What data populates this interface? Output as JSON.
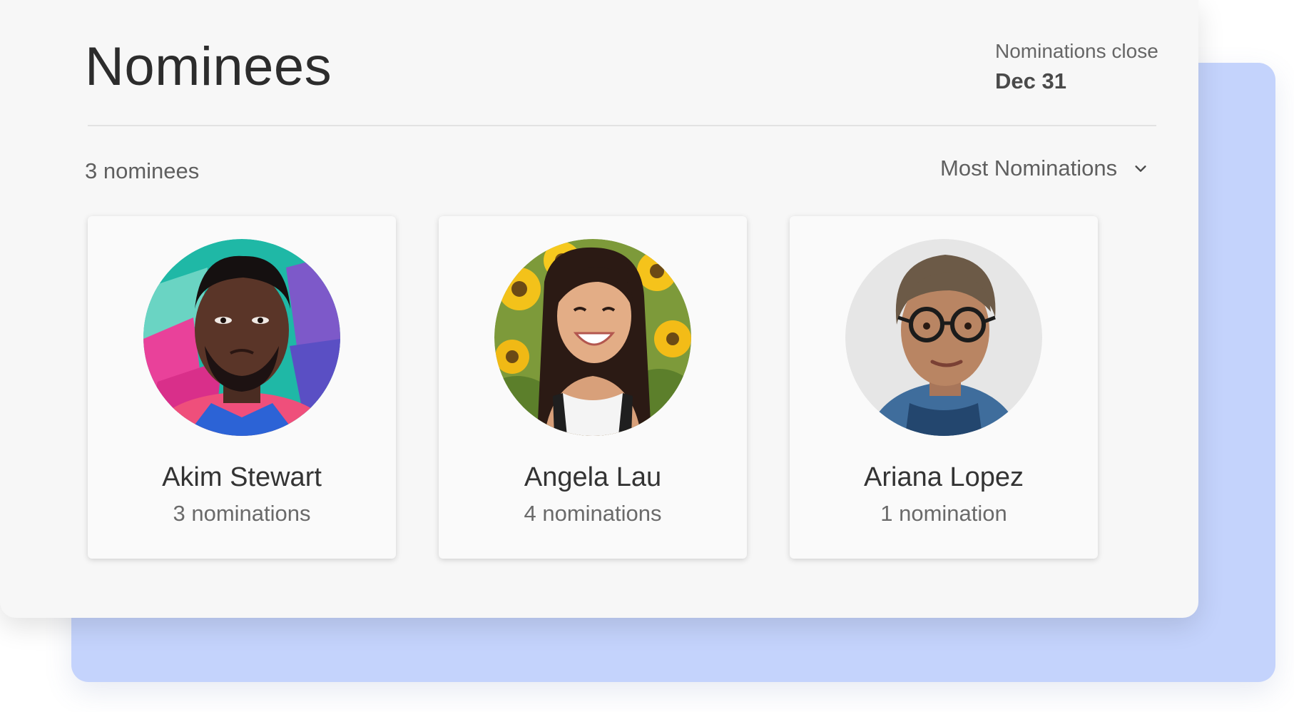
{
  "header": {
    "title": "Nominees",
    "close_label": "Nominations close",
    "close_date": "Dec 31"
  },
  "toolbar": {
    "count_label": "3 nominees",
    "sort_label": "Most Nominations",
    "sort_icon": "chevron-down-icon"
  },
  "nominees": [
    {
      "name": "Akim Stewart",
      "nominations": "3 nominations",
      "photo": "avatar-photo"
    },
    {
      "name": "Angela Lau",
      "nominations": "4 nominations",
      "photo": "avatar-photo"
    },
    {
      "name": "Ariana Lopez",
      "nominations": "1 nomination",
      "photo": "avatar-photo"
    }
  ],
  "colors": {
    "panel": "#f7f7f7",
    "backdrop": "#c4d3fc",
    "title_text": "#2c2c2c",
    "muted_text": "#5f5f5f",
    "card": "#fafafa",
    "divider": "#e2e2e2"
  }
}
